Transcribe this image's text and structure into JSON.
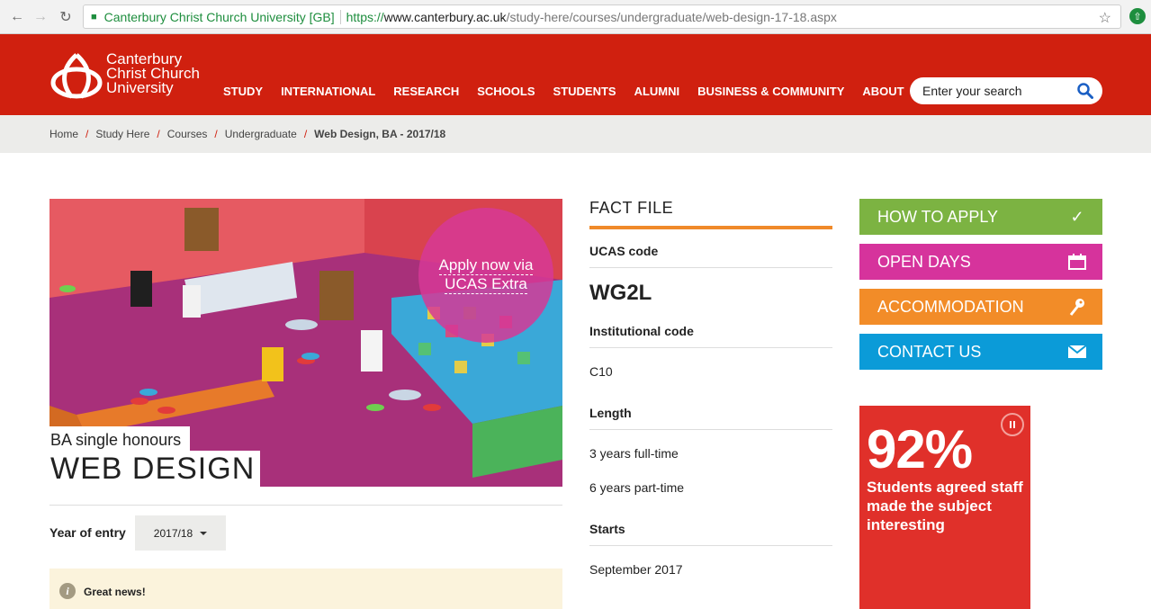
{
  "browser": {
    "site_identity": "Canterbury Christ Church University [GB]",
    "url_scheme": "https://",
    "url_host": "www.canterbury.ac.uk",
    "url_path": "/study-here/courses/undergraduate/web-design-17-18.aspx"
  },
  "header": {
    "logo_lines": [
      "Canterbury",
      "Christ Church",
      "University"
    ],
    "nav": [
      "STUDY",
      "INTERNATIONAL",
      "RESEARCH",
      "SCHOOLS",
      "STUDENTS",
      "ALUMNI",
      "BUSINESS & COMMUNITY",
      "ABOUT"
    ],
    "search_placeholder": "Enter your search"
  },
  "breadcrumb": {
    "items": [
      "Home",
      "Study Here",
      "Courses",
      "Undergraduate"
    ],
    "current": "Web Design, BA - 2017/18"
  },
  "hero": {
    "apply_line1": "Apply now via",
    "apply_line2": "UCAS Extra",
    "subtitle": "BA single honours",
    "title": "WEB DESIGN"
  },
  "entry": {
    "label": "Year of entry",
    "selected": "2017/18"
  },
  "notice": {
    "text": "Great news!"
  },
  "fact_file": {
    "title": "FACT FILE",
    "ucas_label": "UCAS code",
    "ucas_value": "WG2L",
    "inst_label": "Institutional code",
    "inst_value": "C10",
    "length_label": "Length",
    "length_values": [
      "3 years full-time",
      "6 years part-time"
    ],
    "starts_label": "Starts",
    "starts_value": "September 2017"
  },
  "actions": [
    {
      "label": "HOW TO APPLY",
      "color": "#7cb342",
      "icon": "check-icon"
    },
    {
      "label": "OPEN DAYS",
      "color": "#d6339c",
      "icon": "calendar-icon"
    },
    {
      "label": "ACCOMMODATION",
      "color": "#f28c28",
      "icon": "key-icon"
    },
    {
      "label": "CONTACT US",
      "color": "#0b9bd8",
      "icon": "mail-icon"
    }
  ],
  "stat": {
    "value": "92%",
    "text": "Students agreed staff made the subject interesting"
  }
}
